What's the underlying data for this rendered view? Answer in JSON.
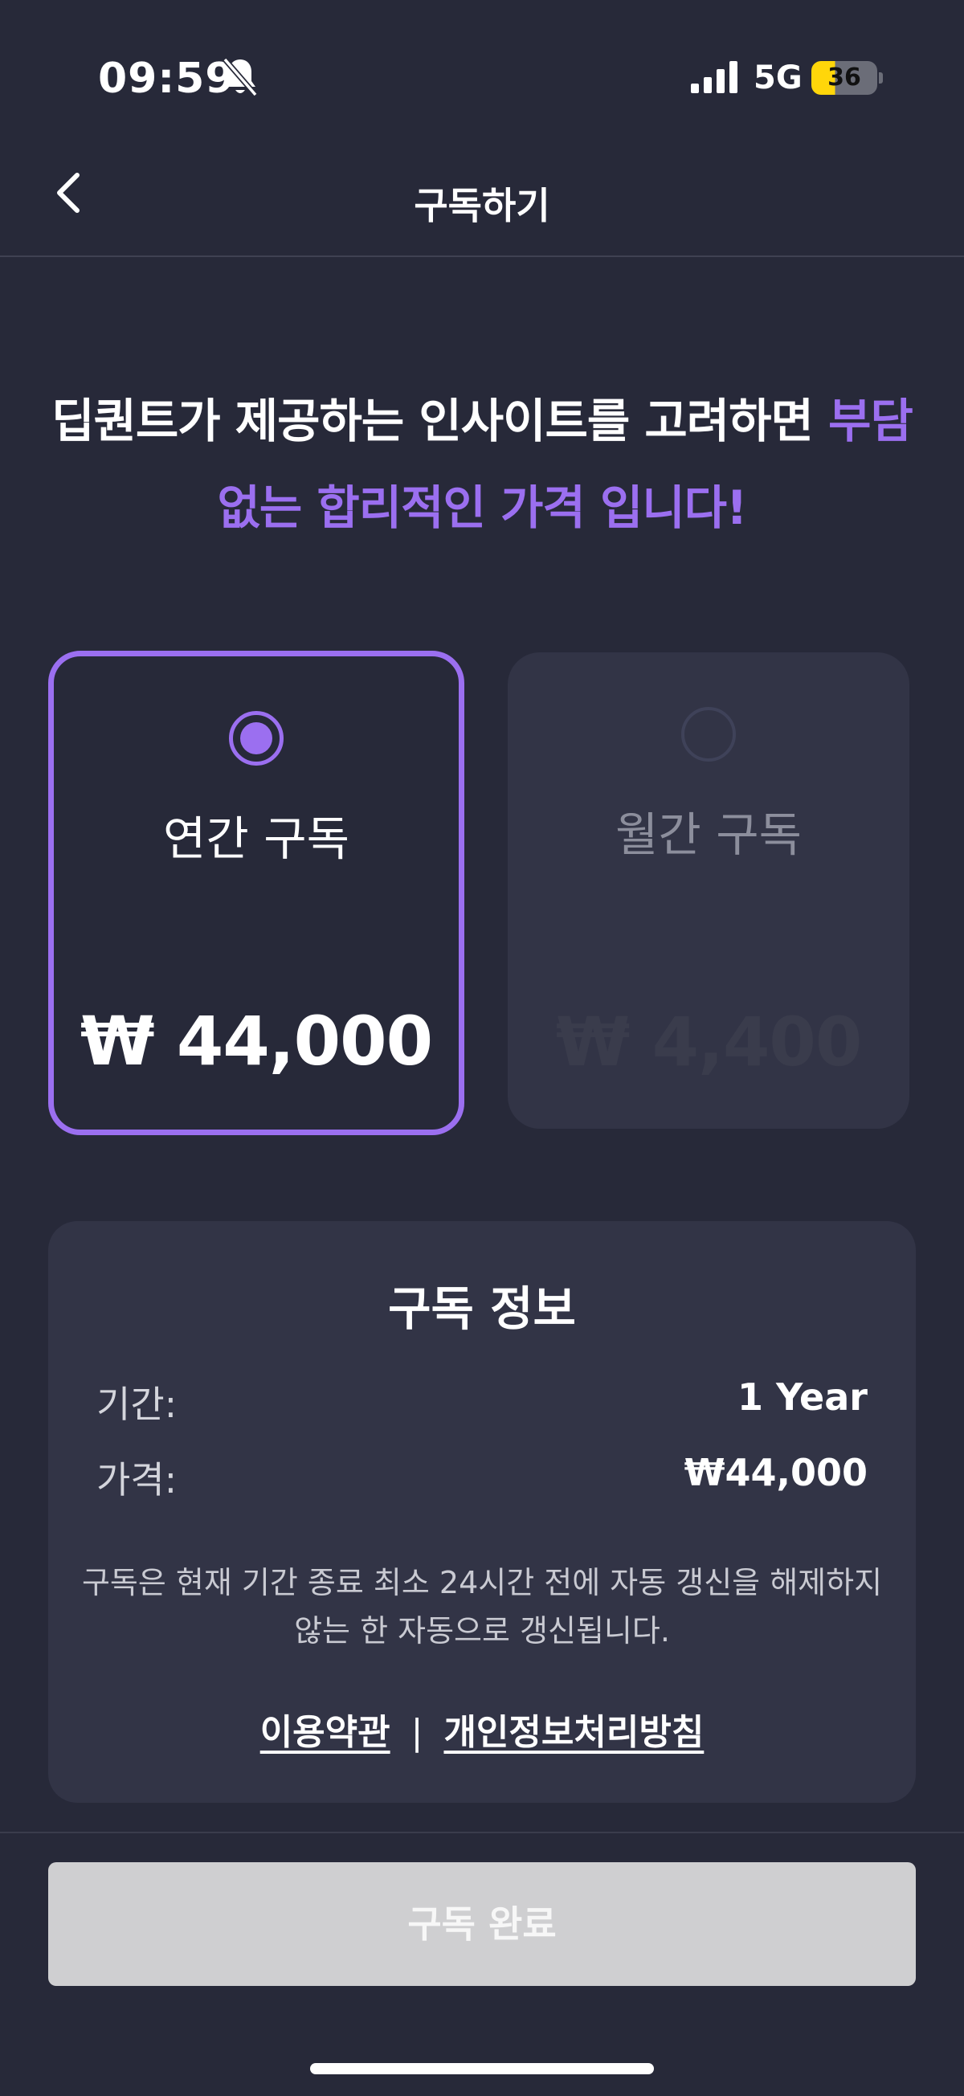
{
  "status_bar": {
    "time": "09:59",
    "network": "5G",
    "battery": "36"
  },
  "header": {
    "title": "구독하기"
  },
  "headline": {
    "text": "딥퀀트가 제공하는 인사이트를 고려하면 ",
    "accent": "부담 없는 합리적인 가격 입니다!"
  },
  "plans": [
    {
      "name": "연간 구독",
      "price": "₩ 44,000",
      "selected": true
    },
    {
      "name": "월간 구독",
      "price": "₩ 4,400",
      "selected": false
    }
  ],
  "info": {
    "title": "구독 정보",
    "period_label": "기간:",
    "period_value": "1 Year",
    "price_label": "가격:",
    "price_value": "₩44,000",
    "note": "구독은 현재 기간 종료 최소 24시간 전에 자동 갱신을 해제하지 않는 한 자동으로 갱신됩니다.",
    "terms_link": "이용약관",
    "separator": "|",
    "privacy_link": "개인정보처리방침"
  },
  "cta": {
    "label": "구독 완료"
  },
  "colors": {
    "background": "#272939",
    "accent": "#9b6ff0",
    "panel": "#323446",
    "cta_disabled": "#cfcfd1"
  }
}
